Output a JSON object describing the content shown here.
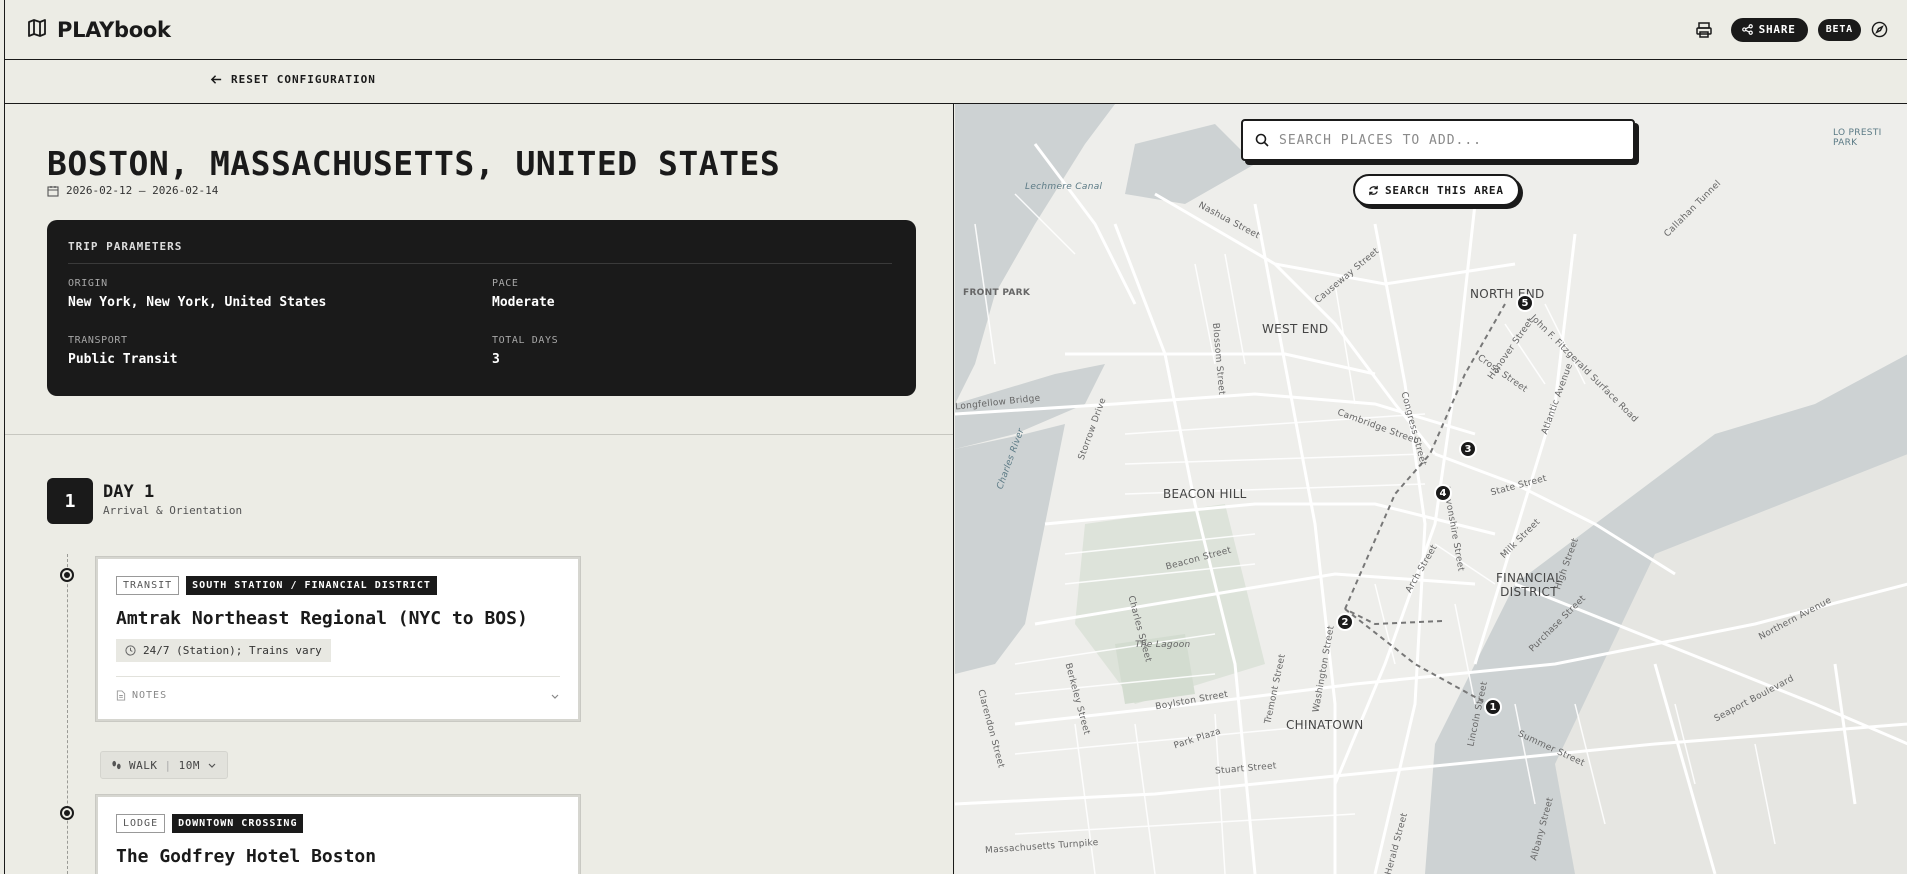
{
  "app": {
    "title": "PLAYbook",
    "share_label": "SHARE",
    "beta_label": "BETA"
  },
  "nav": {
    "reset_label": "RESET CONFIGURATION"
  },
  "trip": {
    "destination": "BOSTON, MASSACHUSETTS, UNITED STATES",
    "date_range": "2026-02-12 — 2026-02-14",
    "params_heading": "TRIP PARAMETERS",
    "origin_label": "ORIGIN",
    "origin": "New York, New York, United States",
    "pace_label": "PACE",
    "pace": "Moderate",
    "transport_label": "TRANSPORT",
    "transport": "Public Transit",
    "days_label": "TOTAL DAYS",
    "days": "3"
  },
  "day": {
    "number": "1",
    "title": "DAY 1",
    "subtitle": "Arrival & Orientation"
  },
  "stops": [
    {
      "type": "TRANSIT",
      "area": "SOUTH STATION / FINANCIAL DISTRICT",
      "name": "Amtrak Northeast Regional (NYC to BOS)",
      "hours": "24/7 (Station); Trains vary",
      "notes_label": "NOTES"
    },
    {
      "type": "LODGE",
      "area": "DOWNTOWN CROSSING",
      "name": "The Godfrey Hotel Boston"
    }
  ],
  "walk": {
    "mode": "WALK",
    "duration": "10M"
  },
  "map": {
    "search_placeholder": "SEARCH PLACES TO ADD...",
    "search_value": "",
    "area_button": "SEARCH THIS AREA",
    "neighborhoods": [
      "NORTH END",
      "WEST END",
      "BEACON HILL",
      "FINANCIAL DISTRICT",
      "CHINATOWN"
    ],
    "streets": [
      "Cambridge Street",
      "Beacon Street",
      "Boylston Street",
      "Congress Street",
      "Atlantic Avenue",
      "Seaport Boulevard",
      "Massachusetts Turnpike",
      "Summer Street",
      "Stuart Street",
      "Longfellow Bridge",
      "Charles River",
      "Lechmere Canal",
      "Storrow Drive",
      "State Street",
      "Washington Street",
      "Park Plaza",
      "Tremont Street",
      "Hanover Street",
      "Milk Street",
      "Causeway Street",
      "Nashua Street",
      "Blossom Street",
      "Clarendon Street",
      "Berkeley Street",
      "Northern Avenue",
      "Charles Street",
      "Arch Street",
      "Devonshire Street",
      "High Street",
      "Purchase Street",
      "Lincoln Street",
      "Albany Street",
      "Herald Street",
      "Callahan Tunnel",
      "John F. Fitzgerald Surface Road",
      "Cross Street"
    ],
    "places": [
      "FRONT PARK",
      "The Lagoon",
      "LO PRESTI PARK"
    ],
    "markers": [
      "1",
      "2",
      "3",
      "4",
      "5"
    ]
  }
}
